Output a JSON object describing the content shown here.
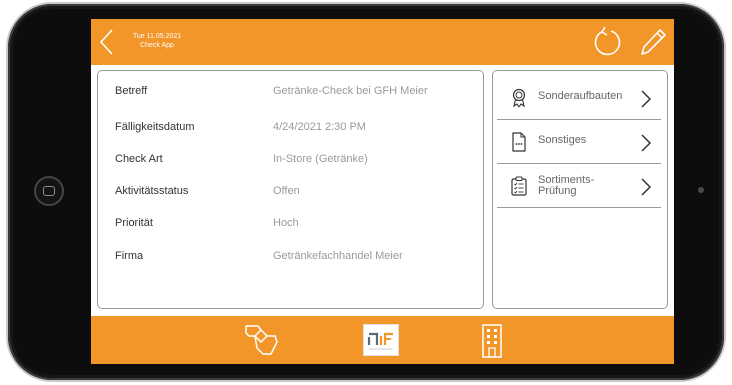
{
  "header": {
    "date": "Tue 11.05.2021",
    "app_name": "Check App",
    "back_icon": "chevron-left-icon",
    "refresh_icon": "refresh-icon",
    "edit_icon": "pencil-icon"
  },
  "details": [
    {
      "label": "Betreff",
      "value": "Getränke-Check bei GFH Meier"
    },
    {
      "label": "Fälligkeitsdatum",
      "value": "4/24/2021 2:30 PM"
    },
    {
      "label": "Check Art",
      "value": "In-Store (Getränke)"
    },
    {
      "label": "Aktivitätsstatus",
      "value": "Offen"
    },
    {
      "label": "Priorität",
      "value": "Hoch"
    },
    {
      "label": "Firma",
      "value": "Getränkefachhandel Meier"
    }
  ],
  "menu": [
    {
      "label": "Sonderaufbauten",
      "icon": "award-ribbon-icon"
    },
    {
      "label": "Sonstiges",
      "icon": "document-dots-icon"
    },
    {
      "label_line1": "Sortiments-",
      "label_line2": "Prüfung",
      "icon": "clipboard-checklist-icon"
    }
  ],
  "bottom_nav": {
    "left_icon": "handshake-icon",
    "center_icon": "app-logo-icon",
    "right_icon": "building-icon"
  },
  "colors": {
    "accent": "#f2962a",
    "label_text": "#333333",
    "value_text": "#9a9a9a",
    "card_border": "#9a9a9a"
  }
}
